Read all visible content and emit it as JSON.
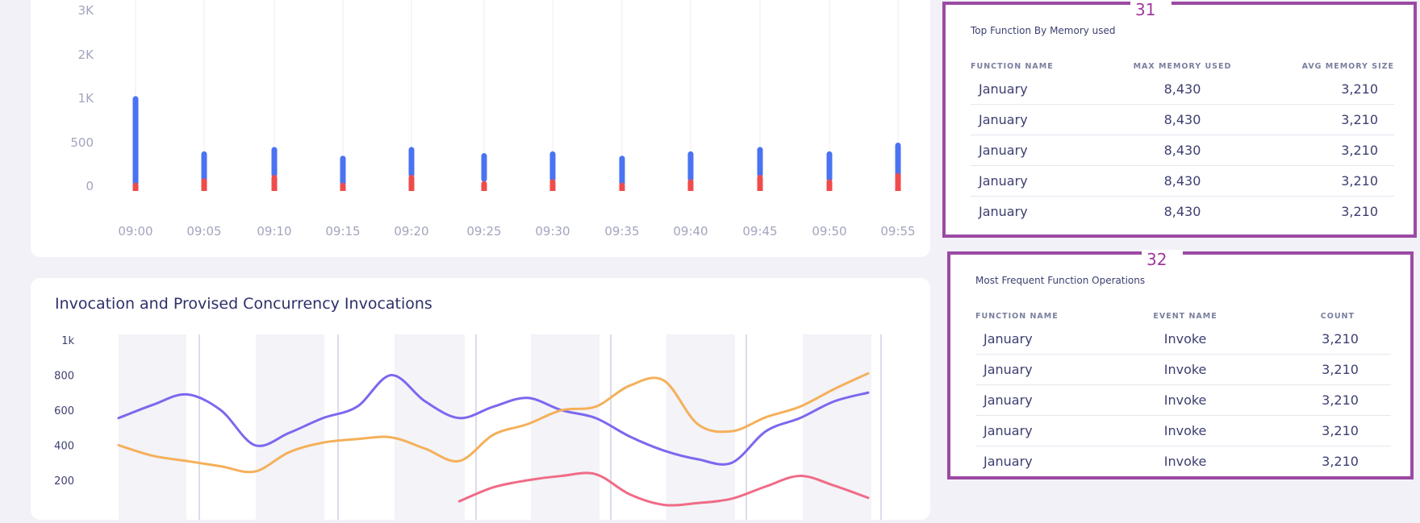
{
  "colors": {
    "blue_bar": "#4a73f2",
    "red_bar": "#ef4b4b",
    "purple_line": "#7b68ee",
    "orange_line": "#f5b05a",
    "pink_line": "#f06b86",
    "highlight_border": "#9b4aa3"
  },
  "chart_data": [
    {
      "type": "bar",
      "title": "",
      "xlabel": "",
      "ylabel": "",
      "ylim": [
        0,
        3000
      ],
      "y_ticks": [
        "3K",
        "2K",
        "1K",
        "500",
        "0"
      ],
      "categories": [
        "09:00",
        "09:05",
        "09:10",
        "09:15",
        "09:20",
        "09:25",
        "09:30",
        "09:35",
        "09:40",
        "09:45",
        "09:50",
        "09:55"
      ],
      "series": [
        {
          "color": "#4a73f2",
          "low": [
            0,
            0,
            100,
            0,
            100,
            50,
            50,
            0,
            50,
            100,
            50,
            100
          ],
          "high": [
            1050,
            400,
            450,
            350,
            450,
            380,
            400,
            350,
            400,
            450,
            400,
            500
          ]
        },
        {
          "color": "#ef4b4b",
          "values": [
            40,
            90,
            130,
            40,
            130,
            60,
            80,
            40,
            80,
            130,
            80,
            150
          ]
        }
      ],
      "grid": true
    },
    {
      "type": "line",
      "title": "Invocation and Provised Concurrency Invocations",
      "y_ticks": [
        "1k",
        "800",
        "600",
        "400",
        "200"
      ],
      "ylim": [
        0,
        1000
      ],
      "x": [
        0,
        0.5,
        1,
        1.5,
        2,
        2.5,
        3,
        3.5,
        4,
        4.5,
        5,
        5.5,
        6,
        6.5,
        7,
        7.5,
        8,
        8.5,
        9,
        9.5,
        10,
        10.5,
        11
      ],
      "series": [
        {
          "color": "#7b68ee",
          "values": [
            555,
            630,
            690,
            600,
            400,
            470,
            555,
            620,
            800,
            650,
            555,
            620,
            670,
            600,
            555,
            450,
            370,
            320,
            300,
            480,
            555,
            650,
            700
          ]
        },
        {
          "color": "#f5b05a",
          "values": [
            400,
            340,
            310,
            280,
            250,
            360,
            415,
            435,
            445,
            380,
            310,
            460,
            520,
            600,
            620,
            740,
            770,
            520,
            480,
            560,
            620,
            720,
            810
          ]
        },
        {
          "color": "#f06b86",
          "values": [
            null,
            null,
            null,
            null,
            null,
            null,
            null,
            null,
            null,
            null,
            80,
            160,
            200,
            225,
            235,
            120,
            60,
            70,
            95,
            165,
            225,
            170,
            100
          ]
        }
      ],
      "grid": true
    }
  ],
  "side_tables": [
    {
      "number": "31",
      "title": "Top Function By Memory used",
      "headers": [
        "FUNCTION NAME",
        "MAX MEMORY USED",
        "AVG MEMORY SIZE"
      ],
      "rows": [
        [
          "January",
          "8,430",
          "3,210"
        ],
        [
          "January",
          "8,430",
          "3,210"
        ],
        [
          "January",
          "8,430",
          "3,210"
        ],
        [
          "January",
          "8,430",
          "3,210"
        ],
        [
          "January",
          "8,430",
          "3,210"
        ]
      ]
    },
    {
      "number": "32",
      "title": "Most Frequent Function Operations",
      "headers": [
        "FUNCTION NAME",
        "EVENT NAME",
        "COUNT"
      ],
      "rows": [
        [
          "January",
          "Invoke",
          "3,210"
        ],
        [
          "January",
          "Invoke",
          "3,210"
        ],
        [
          "January",
          "Invoke",
          "3,210"
        ],
        [
          "January",
          "Invoke",
          "3,210"
        ],
        [
          "January",
          "Invoke",
          "3,210"
        ]
      ]
    }
  ]
}
